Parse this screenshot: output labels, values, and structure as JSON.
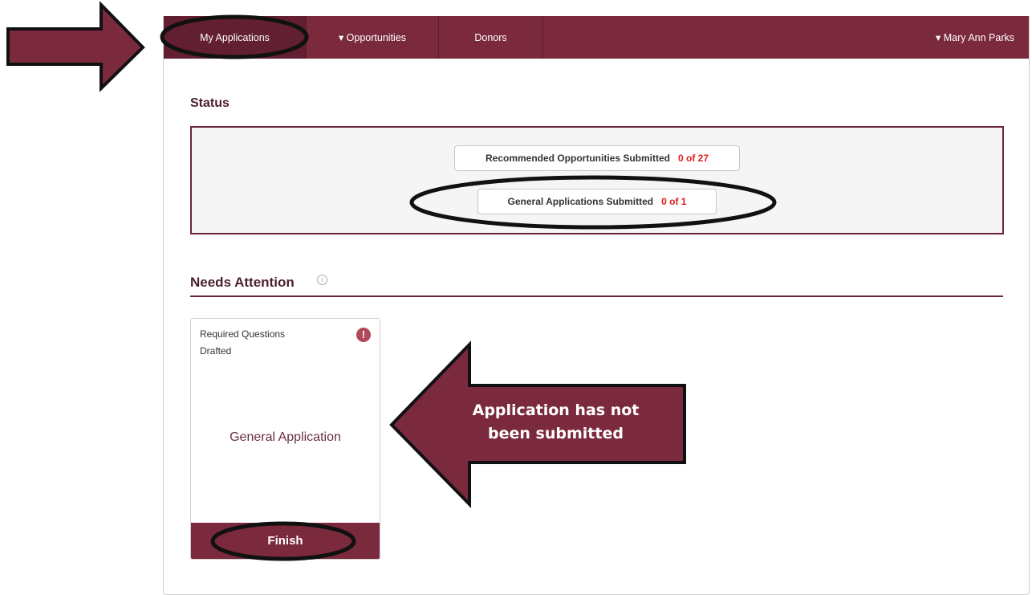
{
  "nav": {
    "items": [
      {
        "label": "My Applications"
      },
      {
        "label": "▾ Opportunities"
      },
      {
        "label": "Donors"
      }
    ],
    "user": "▾ Mary Ann Parks"
  },
  "status": {
    "title": "Status",
    "recommended": {
      "label": "Recommended Opportunities Submitted",
      "value": "0 of 27"
    },
    "general": {
      "label": "General Applications Submitted",
      "value": "0 of 1"
    }
  },
  "attention": {
    "title": "Needs Attention",
    "info_glyph": "i",
    "card": {
      "line1": "Required Questions",
      "line2": "Drafted",
      "alert_glyph": "!",
      "name": "General Application",
      "button": "Finish"
    }
  },
  "annotation": {
    "callout": "Application has not been submitted"
  },
  "colors": {
    "brand": "#7b2a3e",
    "value_red": "#e01b1b",
    "heading": "#4b1f2c"
  }
}
